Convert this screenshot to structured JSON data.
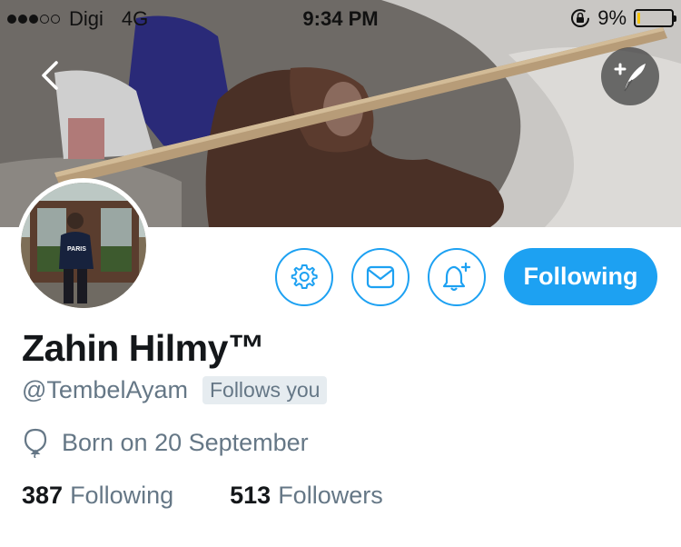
{
  "status_bar": {
    "carrier": "Digi",
    "network": "4G",
    "time": "9:34 PM",
    "battery_percent": "9%",
    "battery_level": 0.09,
    "signal_bars_filled": 3,
    "signal_bars_total": 5
  },
  "nav": {
    "back_icon": "chevron-left-icon",
    "compose_icon": "compose-tweet-icon"
  },
  "profile": {
    "display_name": "Zahin Hilmy™",
    "handle": "@TembelAyam",
    "follows_you_badge": "Follows you",
    "birthday": "Born on 20 September",
    "birthday_icon": "balloon-icon"
  },
  "actions": {
    "settings_icon": "gear-icon",
    "message_icon": "envelope-icon",
    "notify_icon": "bell-plus-icon",
    "following_label": "Following"
  },
  "stats": {
    "following_count": "387",
    "following_label": "Following",
    "followers_count": "513",
    "followers_label": "Followers"
  },
  "colors": {
    "accent": "#1da1f2",
    "primary_text": "#14171a",
    "secondary_text": "#657786",
    "badge_bg": "#e6ecf0",
    "battery_low": "#f5c400"
  }
}
